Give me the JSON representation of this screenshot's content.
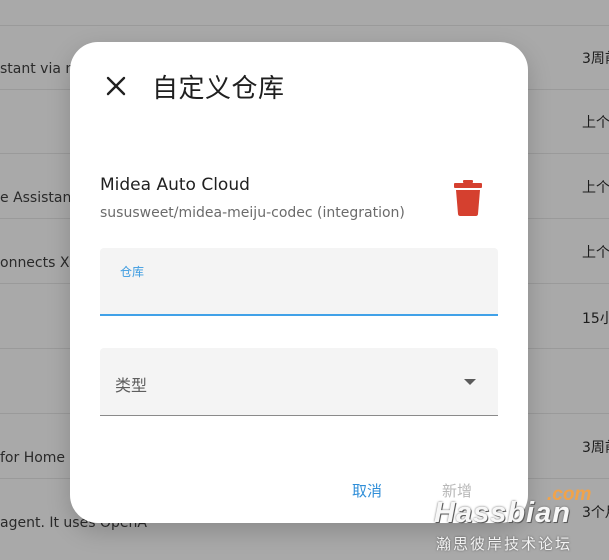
{
  "background": {
    "rows": [
      {
        "text": "",
        "meta": ""
      },
      {
        "text": "stant via m",
        "meta": "3周前"
      },
      {
        "text": "",
        "meta": "上个"
      },
      {
        "text": "e Assistan",
        "meta": "上个"
      },
      {
        "text": "onnects X",
        "meta": "上个"
      },
      {
        "text": "",
        "meta": "15小"
      },
      {
        "text": "",
        "meta": ""
      },
      {
        "text": " for Home",
        "meta": "3周前"
      },
      {
        "text": " agent. It uses OpenA",
        "meta": "3个月"
      }
    ]
  },
  "dialog": {
    "close_icon": "close-icon",
    "title": "自定义仓库",
    "repository": {
      "name": "Midea Auto Cloud",
      "path": "sususweet/midea-meiju-codec (integration)",
      "delete_icon": "trash-icon",
      "delete_color": "#d5402f"
    },
    "repo_field": {
      "label": "仓库",
      "value": ""
    },
    "type_field": {
      "label": "类型",
      "caret_icon": "dropdown-caret-icon"
    },
    "actions": {
      "cancel": "取消",
      "add": "新增"
    }
  },
  "watermark": {
    "suffix": ".com",
    "brand": "Hassbian",
    "subtitle": "瀚思彼岸技术论坛"
  },
  "colors": {
    "accent": "#40a1e8",
    "danger": "#d5402f",
    "disabled": "#b8b8b8"
  }
}
